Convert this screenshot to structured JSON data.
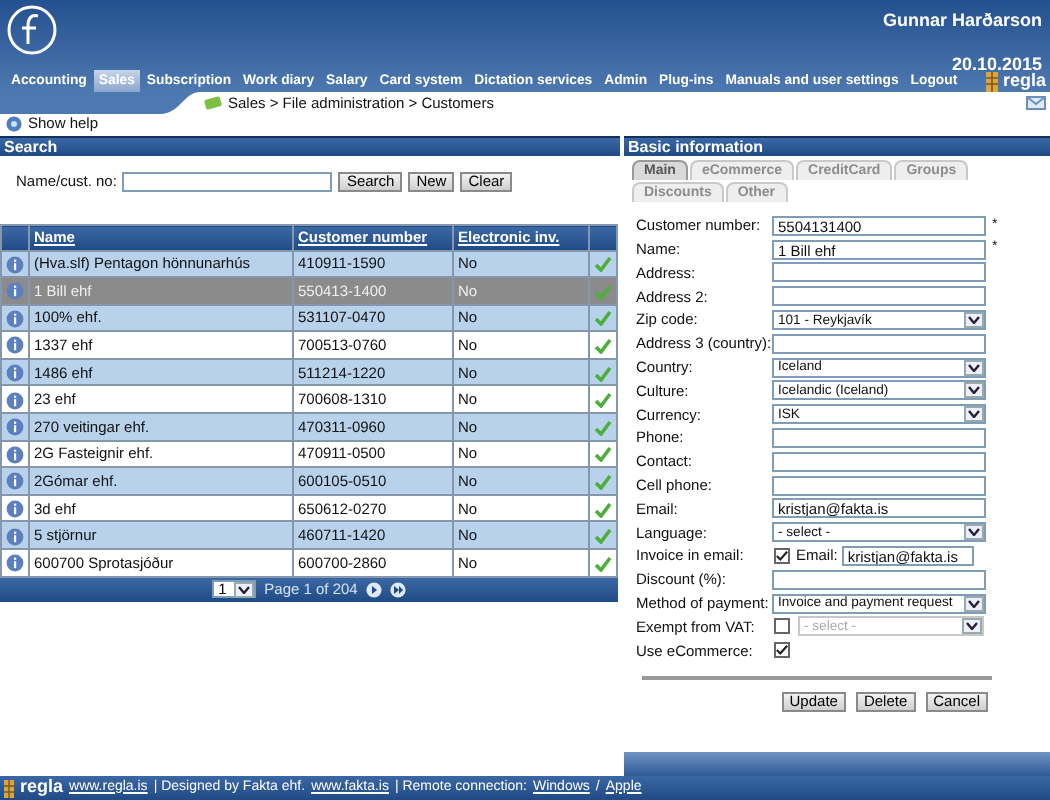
{
  "header": {
    "user": "Gunnar Harðarson",
    "date": "20.10.2015",
    "brand": "regla"
  },
  "nav": [
    {
      "label": "Accounting",
      "selected": false
    },
    {
      "label": "Sales",
      "selected": true
    },
    {
      "label": "Subscription",
      "selected": false
    },
    {
      "label": "Work diary",
      "selected": false
    },
    {
      "label": "Salary",
      "selected": false
    },
    {
      "label": "Card system",
      "selected": false
    },
    {
      "label": "Dictation services",
      "selected": false
    },
    {
      "label": "Admin",
      "selected": false
    },
    {
      "label": "Plug-ins",
      "selected": false
    },
    {
      "label": "Manuals and user settings",
      "selected": false
    },
    {
      "label": "Logout",
      "selected": false
    }
  ],
  "breadcrumb": "Sales > File administration > Customers",
  "help": "Show help",
  "search": {
    "title": "Search",
    "label": "Name/cust. no:",
    "buttons": [
      "Search",
      "New",
      "Clear"
    ]
  },
  "table": {
    "columns": [
      "Name",
      "Customer number",
      "Electronic inv."
    ],
    "rows": [
      {
        "name": "(Hva.slf) Pentagon hönnunarhús",
        "number": "410911-1590",
        "einv": "No",
        "selected": false,
        "checked": true
      },
      {
        "name": "1 Bill ehf",
        "number": "550413-1400",
        "einv": "No",
        "selected": true,
        "checked": true
      },
      {
        "name": "100% ehf.",
        "number": "531107-0470",
        "einv": "No",
        "selected": false,
        "checked": true
      },
      {
        "name": "1337 ehf",
        "number": "700513-0760",
        "einv": "No",
        "selected": false,
        "checked": true
      },
      {
        "name": "1486 ehf",
        "number": "511214-1220",
        "einv": "No",
        "selected": false,
        "checked": true
      },
      {
        "name": "23 ehf",
        "number": "700608-1310",
        "einv": "No",
        "selected": false,
        "checked": true
      },
      {
        "name": "270 veitingar ehf.",
        "number": "470311-0960",
        "einv": "No",
        "selected": false,
        "checked": true
      },
      {
        "name": "2G Fasteignir ehf.",
        "number": "470911-0500",
        "einv": "No",
        "selected": false,
        "checked": true
      },
      {
        "name": "2Gómar ehf.",
        "number": "600105-0510",
        "einv": "No",
        "selected": false,
        "checked": true
      },
      {
        "name": "3d ehf",
        "number": "650612-0270",
        "einv": "No",
        "selected": false,
        "checked": true
      },
      {
        "name": "5 stjörnur",
        "number": "460711-1420",
        "einv": "No",
        "selected": false,
        "checked": true
      },
      {
        "name": "600700 Sprotasjóður",
        "number": "600700-2860",
        "einv": "No",
        "selected": false,
        "checked": true
      }
    ],
    "pager": {
      "page": "1",
      "text": "Page 1 of 204"
    }
  },
  "details": {
    "title": "Basic information",
    "tabs": [
      {
        "label": "Main",
        "selected": true
      },
      {
        "label": "eCommerce",
        "selected": false
      },
      {
        "label": "CreditCard",
        "selected": false
      },
      {
        "label": "Groups",
        "selected": false
      },
      {
        "label": "Discounts",
        "selected": false
      },
      {
        "label": "Other",
        "selected": false
      }
    ],
    "fields": [
      {
        "kind": "text",
        "label": "Customer number:",
        "value": "5504131400",
        "marker": "*"
      },
      {
        "kind": "text",
        "label": "Name:",
        "value": "1 Bill ehf",
        "marker": "*"
      },
      {
        "kind": "text",
        "label": "Address:"
      },
      {
        "kind": "text",
        "label": "Address 2:"
      },
      {
        "kind": "select",
        "label": "Zip code:",
        "value": "101 - Reykjavík"
      },
      {
        "kind": "text",
        "label": "Address 3 (country):"
      },
      {
        "kind": "select",
        "label": "Country:",
        "value": "Iceland"
      },
      {
        "kind": "select",
        "label": "Culture:",
        "value": "Icelandic (Iceland)"
      },
      {
        "kind": "select",
        "label": "Currency:",
        "value": "ISK"
      },
      {
        "kind": "text",
        "label": "Phone:"
      },
      {
        "kind": "text",
        "label": "Contact:"
      },
      {
        "kind": "text",
        "label": "Cell phone:"
      },
      {
        "kind": "text",
        "label": "Email:",
        "value": "kristjan@fakta.is"
      },
      {
        "kind": "select",
        "label": "Language:",
        "value": "- select -"
      },
      {
        "kind": "checkemail",
        "label": "Invoice in email:",
        "checked": true,
        "sublabel": "Email:",
        "value": "kristjan@fakta.is"
      },
      {
        "kind": "text",
        "label": "Discount (%):"
      },
      {
        "kind": "select",
        "label": "Method of payment:",
        "value": "Invoice and payment request"
      },
      {
        "kind": "checkselect",
        "label": "Exempt from VAT:",
        "checked": false,
        "value": "- select -",
        "disabled": true
      },
      {
        "kind": "check",
        "label": "Use eCommerce:",
        "checked": true
      }
    ],
    "buttons": [
      "Update",
      "Delete",
      "Cancel"
    ]
  },
  "footer": {
    "brand": "regla",
    "segments": [
      {
        "text": "www.regla.is",
        "link": true
      },
      {
        "text": "| Designed by Fakta ehf.",
        "link": false
      },
      {
        "text": "www.fakta.is",
        "link": true
      },
      {
        "text": "| Remote connection:",
        "link": false
      },
      {
        "text": "Windows",
        "link": true
      },
      {
        "text": "/",
        "link": false
      },
      {
        "text": "Apple",
        "link": true
      }
    ]
  }
}
